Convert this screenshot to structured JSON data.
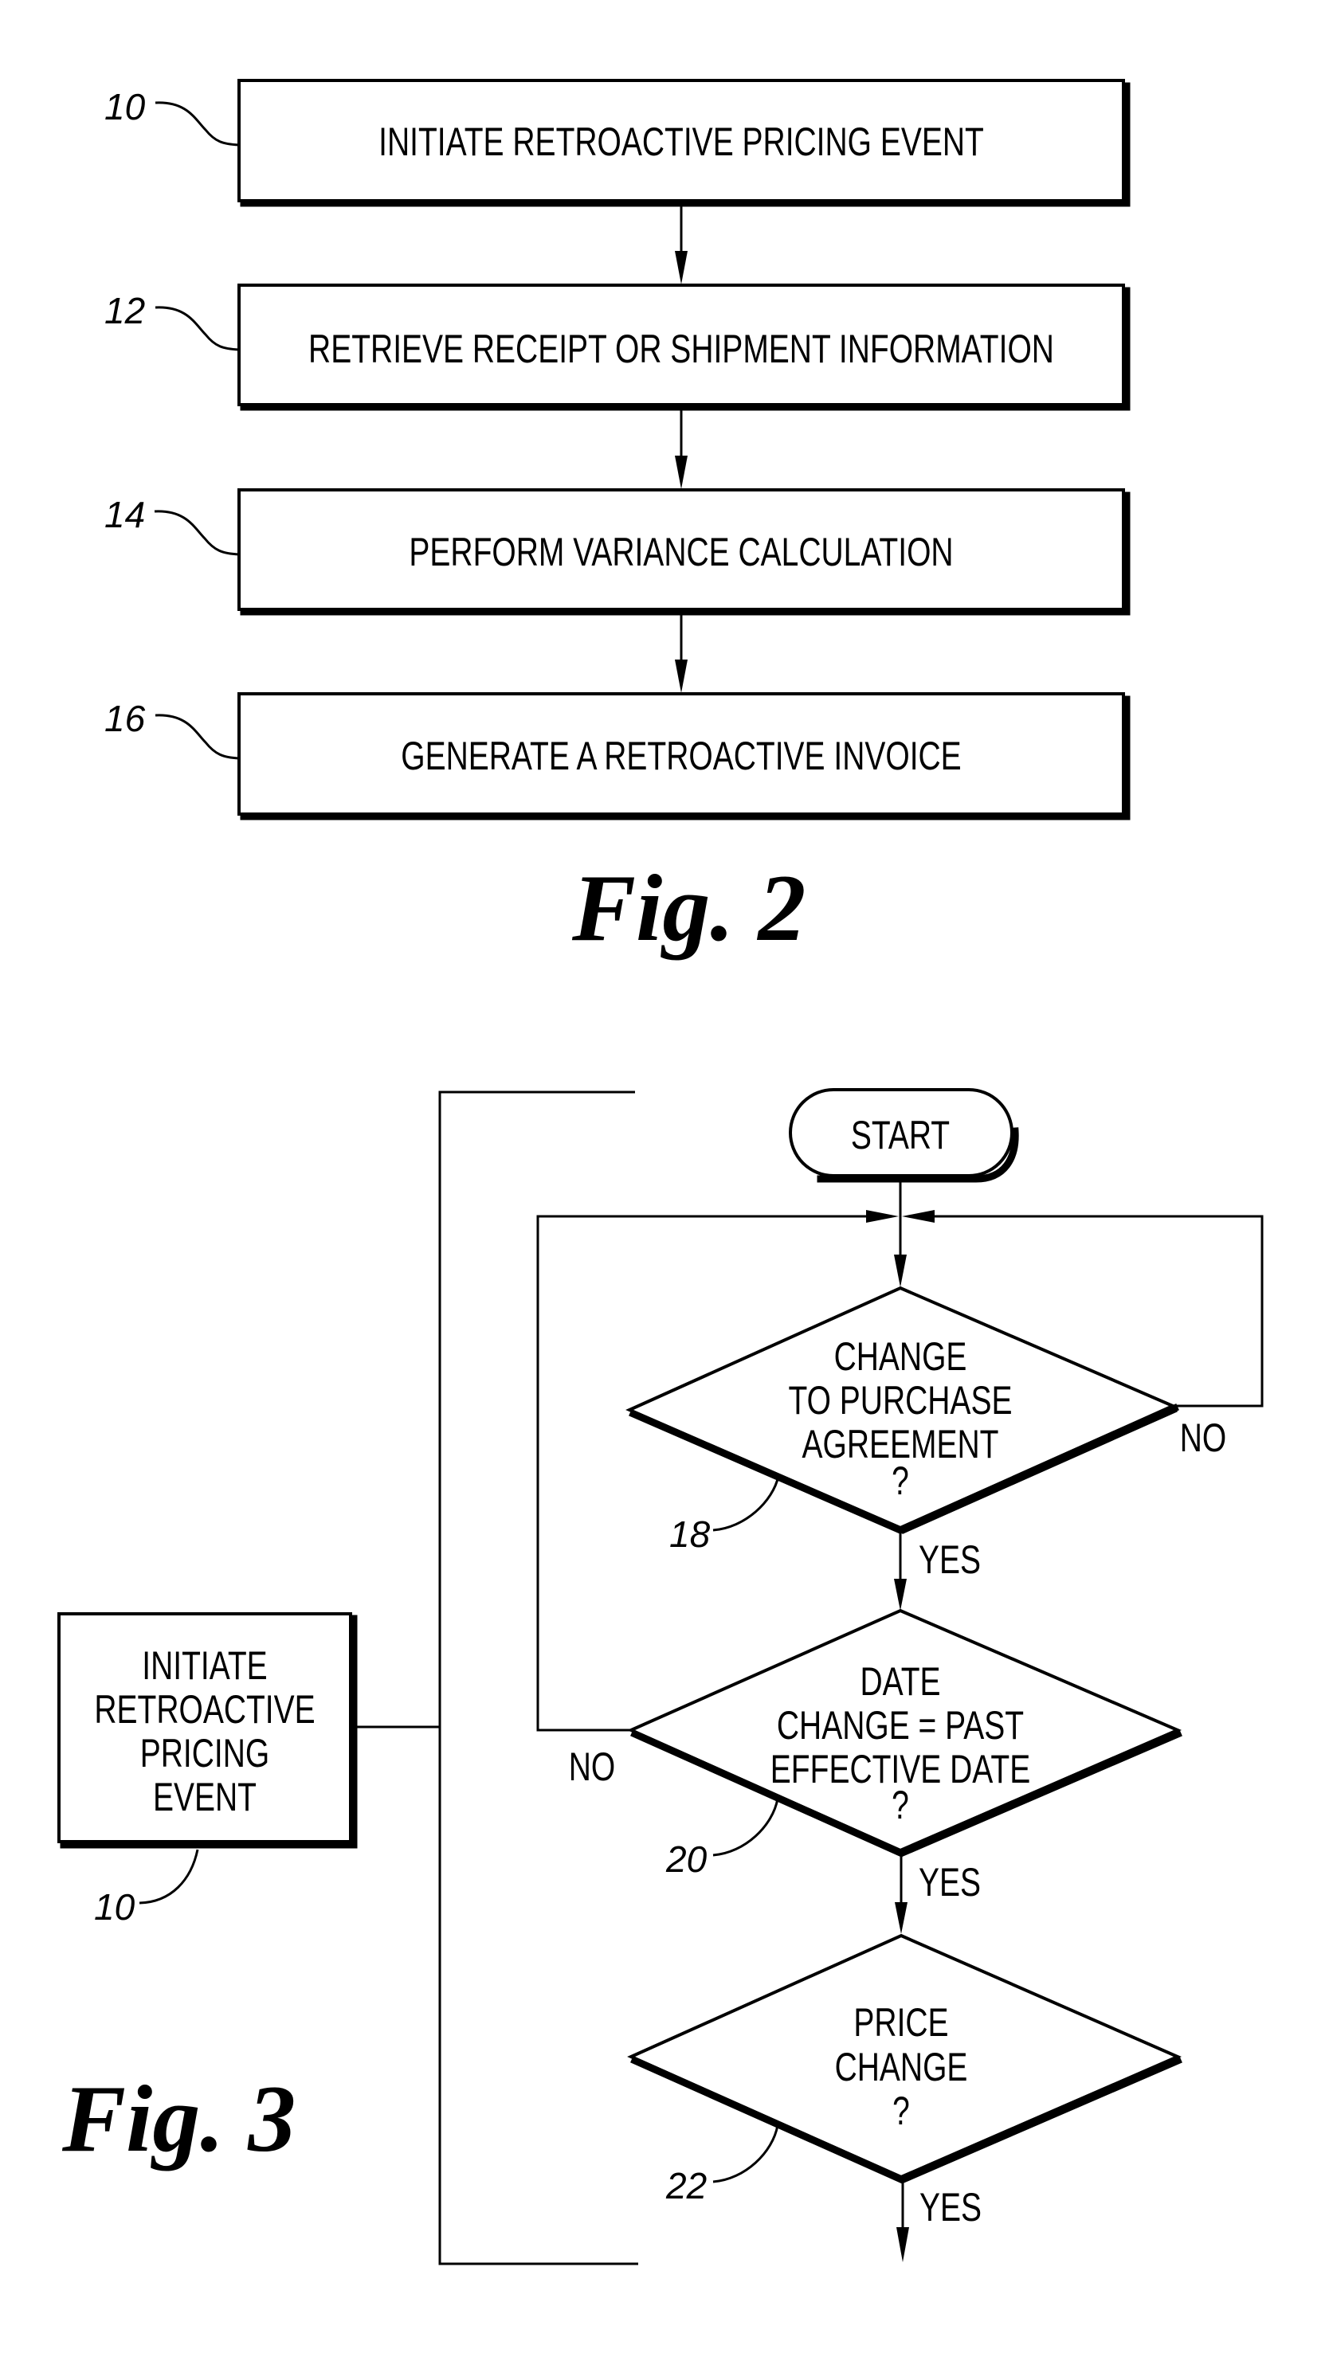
{
  "fig2": {
    "caption": "Fig. 2",
    "steps": [
      {
        "ref": "10",
        "label": "INITIATE RETROACTIVE PRICING EVENT"
      },
      {
        "ref": "12",
        "label": "RETRIEVE RECEIPT OR SHIPMENT INFORMATION"
      },
      {
        "ref": "14",
        "label": "PERFORM VARIANCE CALCULATION"
      },
      {
        "ref": "16",
        "label": "GENERATE A RETROACTIVE INVOICE"
      }
    ]
  },
  "fig3": {
    "caption": "Fig. 3",
    "side_box": {
      "ref": "10",
      "lines": [
        "INITIATE",
        "RETROACTIVE",
        "PRICING",
        "EVENT"
      ]
    },
    "start_label": "START",
    "decisions": [
      {
        "ref": "18",
        "lines": [
          "CHANGE",
          "TO PURCHASE",
          "AGREEMENT",
          "?"
        ],
        "yes_label": "YES",
        "no_label": "NO"
      },
      {
        "ref": "20",
        "lines": [
          "DATE",
          "CHANGE = PAST",
          "EFFECTIVE DATE",
          "?"
        ],
        "yes_label": "YES",
        "no_label": "NO"
      },
      {
        "ref": "22",
        "lines": [
          "PRICE",
          "CHANGE",
          "?"
        ],
        "yes_label": "YES"
      }
    ]
  }
}
